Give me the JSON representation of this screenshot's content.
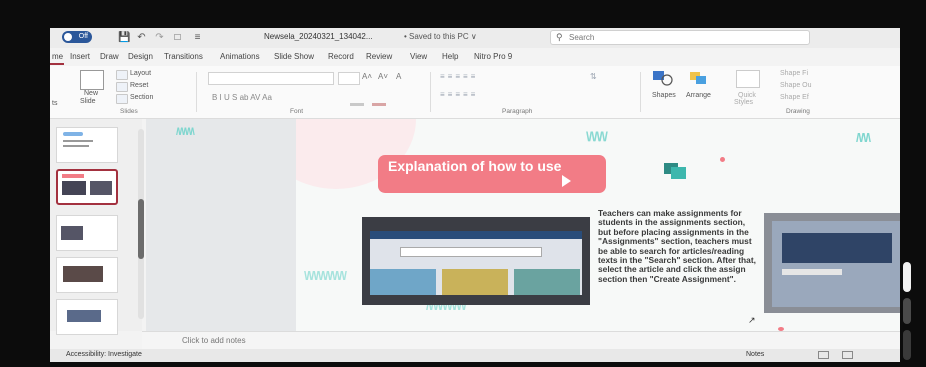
{
  "titlebar": {
    "autosave_label": "Off",
    "filename": "Newsela_20240321_134042...",
    "save_status": "• Saved to this PC ∨",
    "search_placeholder": "Search"
  },
  "tabs": [
    "me",
    "Insert",
    "Draw",
    "Design",
    "Transitions",
    "Animations",
    "Slide Show",
    "Record",
    "Review",
    "View",
    "Help",
    "Nitro Pro 9"
  ],
  "ribbon": {
    "new_slide": "New",
    "new_slide2": "Slide",
    "layout": "Layout",
    "reset": "Reset",
    "section": "Section",
    "slides_group": "Slides",
    "font_group": "Font",
    "paragraph_group": "Paragraph",
    "drawing_group": "Drawing",
    "shapes": "Shapes",
    "arrange": "Arrange",
    "quick_styles": "Quick",
    "quick_styles2": "Styles",
    "shape_fill": "Shape Fi",
    "shape_outline": "Shape Ou",
    "shape_effects": "Shape Ef",
    "font_size_grow": "A˄",
    "font_size_shrink": "A˅",
    "clear_format": "A",
    "format_row": "B   I   U   S   ab   AV   Aa",
    "left_stub": "ts"
  },
  "slide": {
    "title": "Explanation of how to use",
    "body": "Teachers can make assignments for students in the assignments section, but before placing assignments in the \"Assignments\" section, teachers must be able to search for articles/reading texts in the \"Search\" section. After that, select the article and click the assign section then \"Create Assignment\"."
  },
  "notes_placeholder": "Click to add notes",
  "status": {
    "accessibility": "Accessibility: Investigate",
    "notes_label": "Notes"
  },
  "thumbnails": [
    "",
    "",
    "",
    "",
    ""
  ]
}
